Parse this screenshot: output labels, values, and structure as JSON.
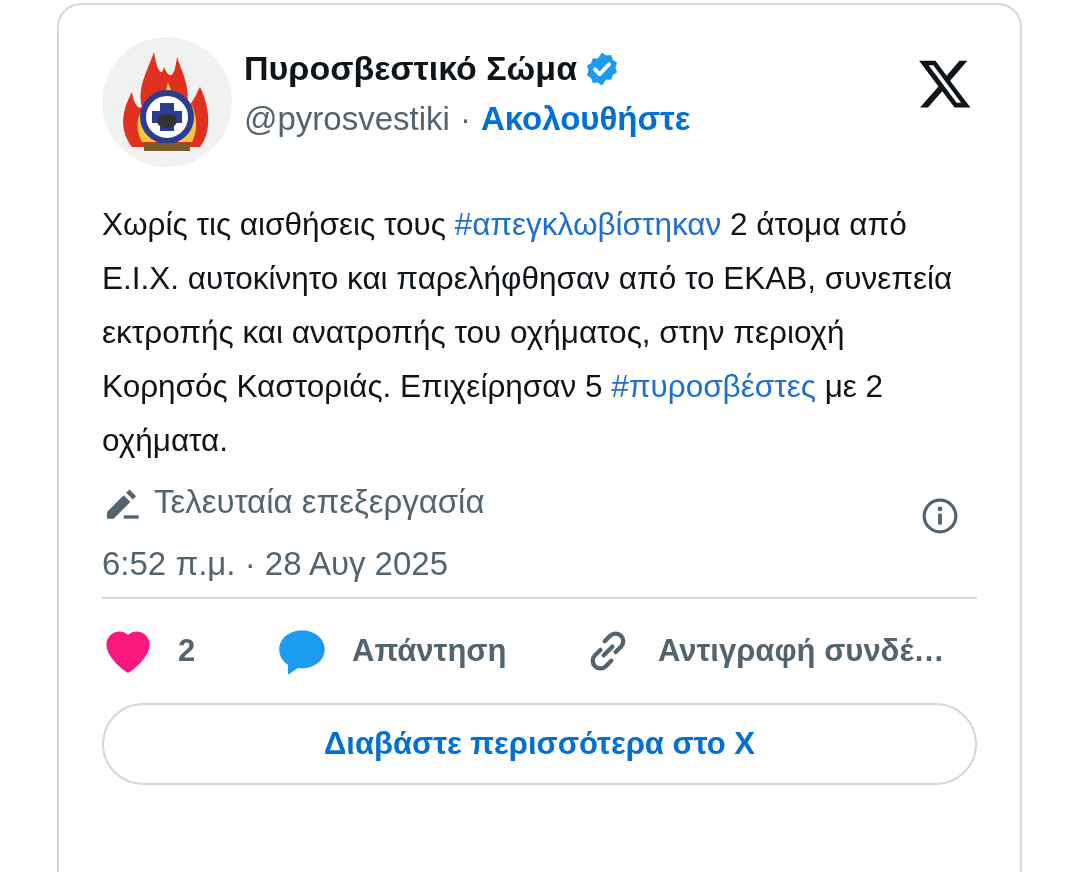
{
  "author": {
    "name": "Πυροσβεστικό Σώμα",
    "verified": true,
    "handle": "@pyrosvestiki",
    "separator": "·",
    "follow": "Ακολουθήστε"
  },
  "body": [
    {
      "kind": "text",
      "text": "Χωρίς τις αισθήσεις τους "
    },
    {
      "kind": "hashtag",
      "text": "#απεγκλωβίστηκαν"
    },
    {
      "kind": "text",
      "text": " 2 άτομα από Ε.Ι.Χ. αυτοκίνητο και παρελήφθησαν από το ΕΚΑΒ, συνεπεία εκτροπής και ανατροπής του οχήματος,  στην  περιοχή Κορησός Καστοριάς. Επιχείρησαν 5 "
    },
    {
      "kind": "hashtag",
      "text": "#πυροσβέστες"
    },
    {
      "kind": "text",
      "text": " με 2 οχήματα."
    }
  ],
  "edited": {
    "label": "Τελευταία επεξεργασία"
  },
  "timestamp": "6:52 π.μ. · 28 Αυγ 2025",
  "actions": {
    "liked": true,
    "like_count": "2",
    "reply": "Απάντηση",
    "copy_link": "Αντιγραφή συνδέ…"
  },
  "read_more": "Διαβάστε περισσότερα στο X"
}
